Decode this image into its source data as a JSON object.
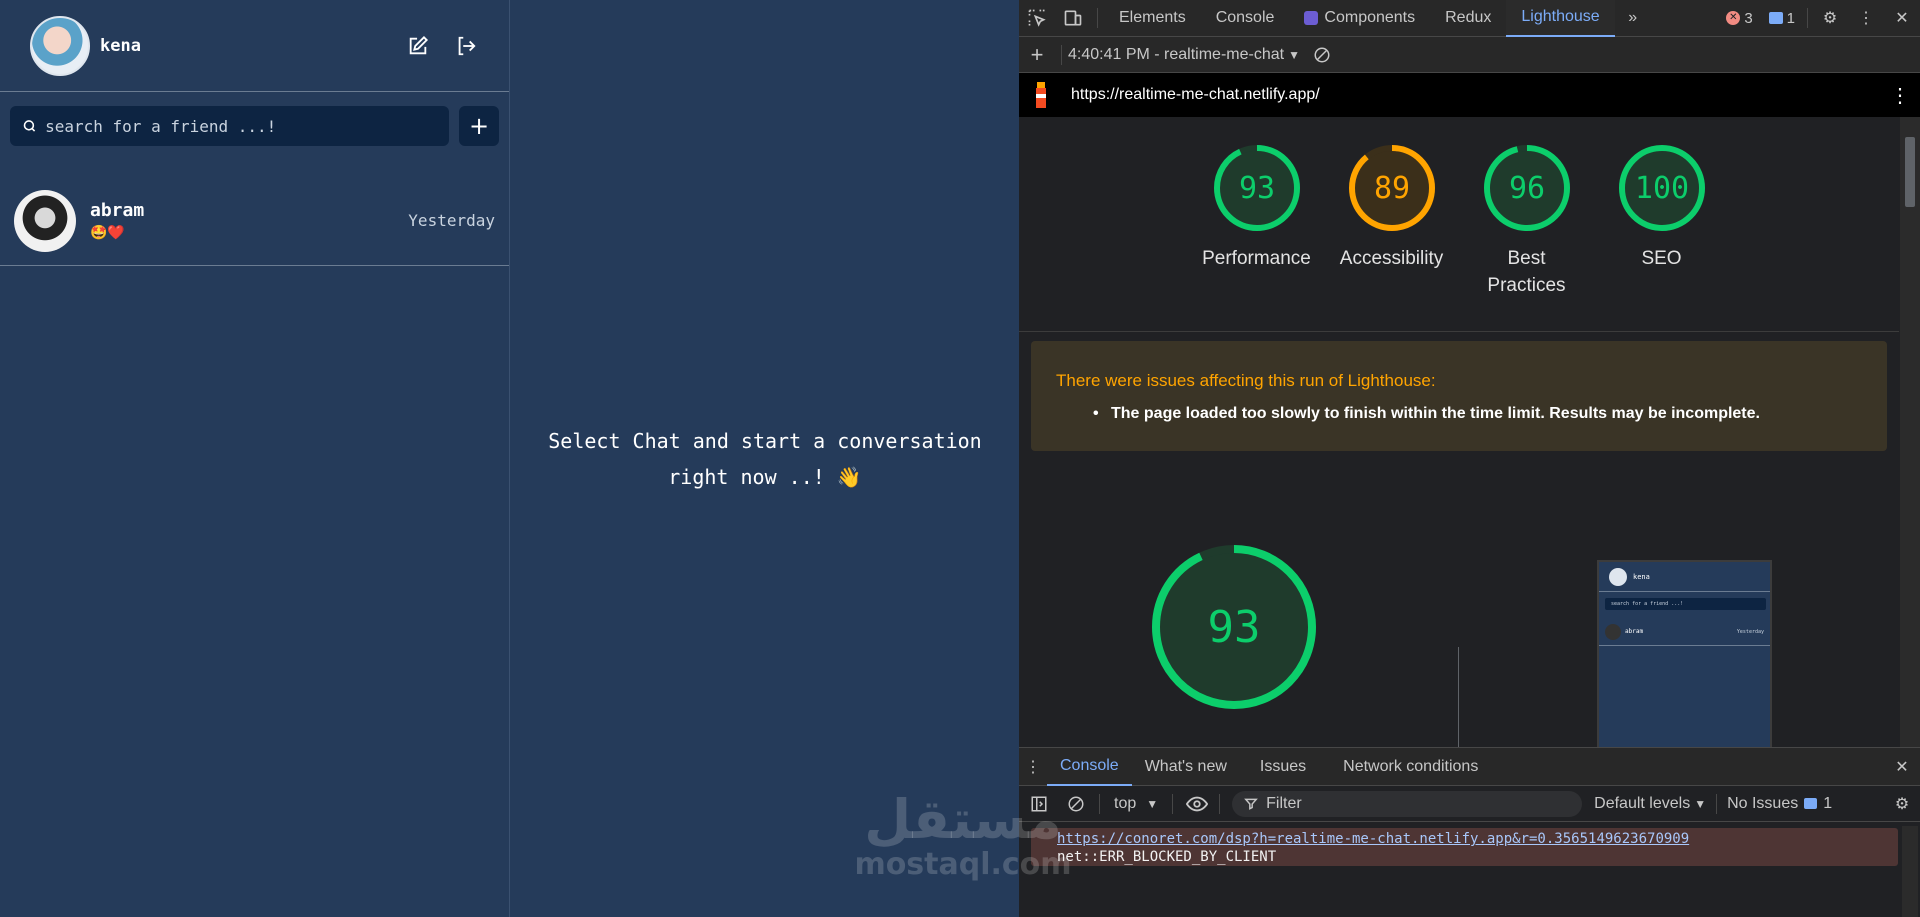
{
  "app": {
    "user": {
      "name": "kena"
    },
    "search": {
      "placeholder": "search for a friend ...!"
    },
    "add_label": "+",
    "friends": [
      {
        "name": "abram",
        "status": "🤩❤️",
        "time": "Yesterday"
      }
    ],
    "empty_message": "Select Chat and start a conversation right now ..! 👋"
  },
  "devtools": {
    "tabs": [
      "Elements",
      "Console",
      "Components",
      "Redux",
      "Lighthouse"
    ],
    "active_tab": "Lighthouse",
    "errors_count": "3",
    "messages_count": "1",
    "report_selector": "4:40:41 PM - realtime-me-chat",
    "url": "https://realtime-me-chat.netlify.app/",
    "scores": [
      {
        "label": "Performance",
        "value": "93",
        "fraction": 0.93,
        "color": "#0cce6b"
      },
      {
        "label": "Accessibility",
        "value": "89",
        "fraction": 0.89,
        "color": "#ffa400"
      },
      {
        "label": "Best Practices",
        "value": "96",
        "fraction": 0.96,
        "color": "#0cce6b"
      },
      {
        "label": "SEO",
        "value": "100",
        "fraction": 1.0,
        "color": "#0cce6b"
      }
    ],
    "warning": {
      "title": "There were issues affecting this run of Lighthouse:",
      "item": "The page loaded too slowly to finish within the time limit. Results may be incomplete."
    },
    "big_score": {
      "value": "93",
      "fraction": 0.93
    },
    "preview": {
      "user": "kena",
      "search": "search for a friend ...!",
      "friend": "abram",
      "time": "Yesterday"
    },
    "drawer_tabs": [
      "Console",
      "What's new",
      "Issues",
      "Network conditions"
    ],
    "drawer_active": "Console",
    "context": "top",
    "filter_placeholder": "Filter",
    "levels": "Default levels",
    "issues_label": "No Issues",
    "issues_count": "1",
    "console_link": "https://conoret.com/dsp?h=realtime-me-chat.netlify.app&r=0.3565149623670909",
    "console_error": "net::ERR_BLOCKED_BY_CLIENT"
  },
  "watermark": {
    "arabic": "مستقل",
    "latin": "mostaql.com"
  }
}
